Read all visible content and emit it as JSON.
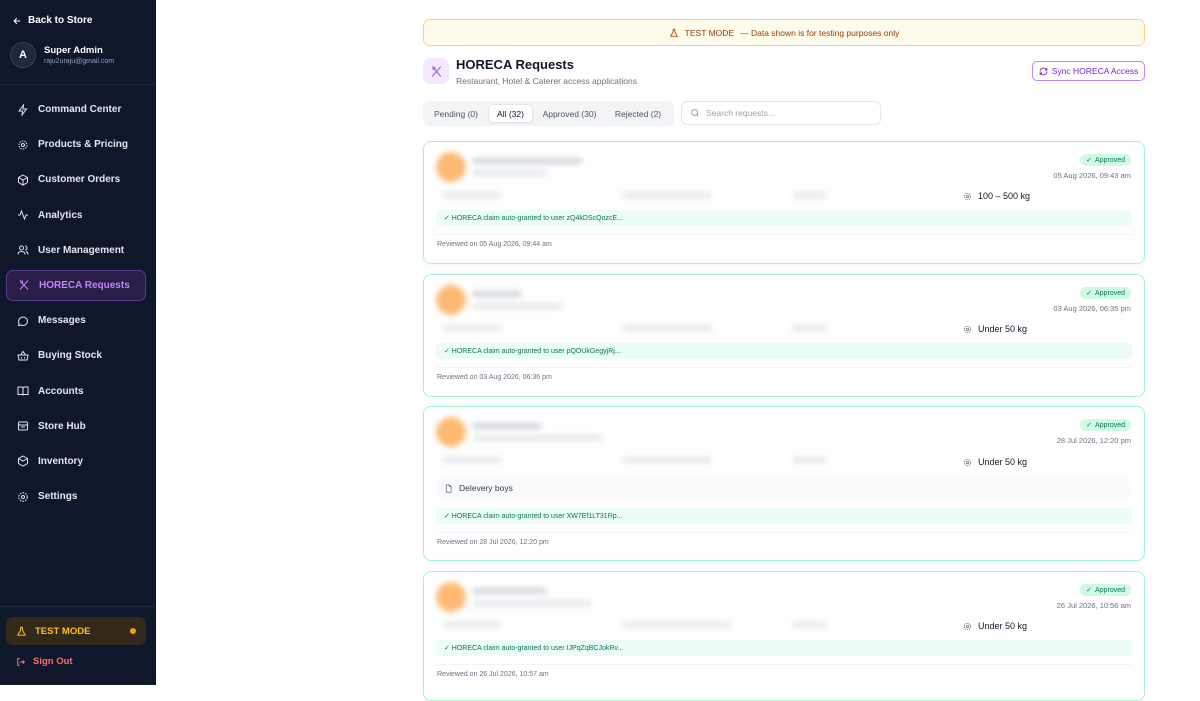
{
  "sidebar": {
    "back_label": "Back to Store",
    "user": {
      "initial": "A",
      "name": "Super Admin",
      "email": "raju2uraju@gmail.com"
    },
    "items": [
      {
        "label": "Command Center",
        "icon": "bolt-icon",
        "active": false
      },
      {
        "label": "Products & Pricing",
        "icon": "gear-icon",
        "active": false
      },
      {
        "label": "Customer Orders",
        "icon": "package-icon",
        "active": false
      },
      {
        "label": "Analytics",
        "icon": "activity-icon",
        "active": false
      },
      {
        "label": "User Management",
        "icon": "users-icon",
        "active": false
      },
      {
        "label": "HORECA Requests",
        "icon": "utensils-icon",
        "active": true
      },
      {
        "label": "Messages",
        "icon": "message-icon",
        "active": false
      },
      {
        "label": "Buying Stock",
        "icon": "basket-icon",
        "active": false
      },
      {
        "label": "Accounts",
        "icon": "book-icon",
        "active": false
      },
      {
        "label": "Store Hub",
        "icon": "store-icon",
        "active": false
      },
      {
        "label": "Inventory",
        "icon": "box-icon",
        "active": false
      },
      {
        "label": "Settings",
        "icon": "settings-icon",
        "active": false
      }
    ],
    "test_mode_label": "TEST MODE",
    "signout_label": "Sign Out"
  },
  "banner": {
    "prefix": "TEST MODE",
    "text": "— Data shown is for testing purposes only"
  },
  "header": {
    "title": "HORECA Requests",
    "subtitle": "Restaurant, Hotel & Caterer access applications",
    "sync_label": "Sync HORECA Access"
  },
  "tabs": [
    {
      "label": "Pending (0)",
      "active": false
    },
    {
      "label": "All (32)",
      "active": true
    },
    {
      "label": "Approved (30)",
      "active": false
    },
    {
      "label": "Rejected (2)",
      "active": false
    }
  ],
  "search": {
    "placeholder": "Search requests..."
  },
  "requests": [
    {
      "status": "Approved",
      "date": "05 Aug 2026, 09:43 am",
      "volume": "100 – 500 kg",
      "note": "",
      "granted": "✓ HORECA claim auto-granted to user zQ4kDScQozcE...",
      "reviewed": "Reviewed on 05 Aug 2026, 09:44 am"
    },
    {
      "status": "Approved",
      "date": "03 Aug 2026, 06:35 pm",
      "volume": "Under 50 kg",
      "note": "",
      "granted": "✓ HORECA claim auto-granted to user pQOUkGegyjRj...",
      "reviewed": "Reviewed on 03 Aug 2026, 06:36 pm"
    },
    {
      "status": "Approved",
      "date": "28 Jul 2026, 12:20 pm",
      "volume": "Under 50 kg",
      "note": "Delevery boys",
      "granted": "✓ HORECA claim auto-granted to user XW7Ef1LT31Rp...",
      "reviewed": "Reviewed on 28 Jul 2026, 12:20 pm"
    },
    {
      "status": "Approved",
      "date": "26 Jul 2026, 10:56 am",
      "volume": "Under 50 kg",
      "note": "",
      "granted": "✓ HORECA claim auto-granted to user IJPqZqBCJokRv...",
      "reviewed": "Reviewed on 26 Jul 2026, 10:57 am"
    }
  ]
}
